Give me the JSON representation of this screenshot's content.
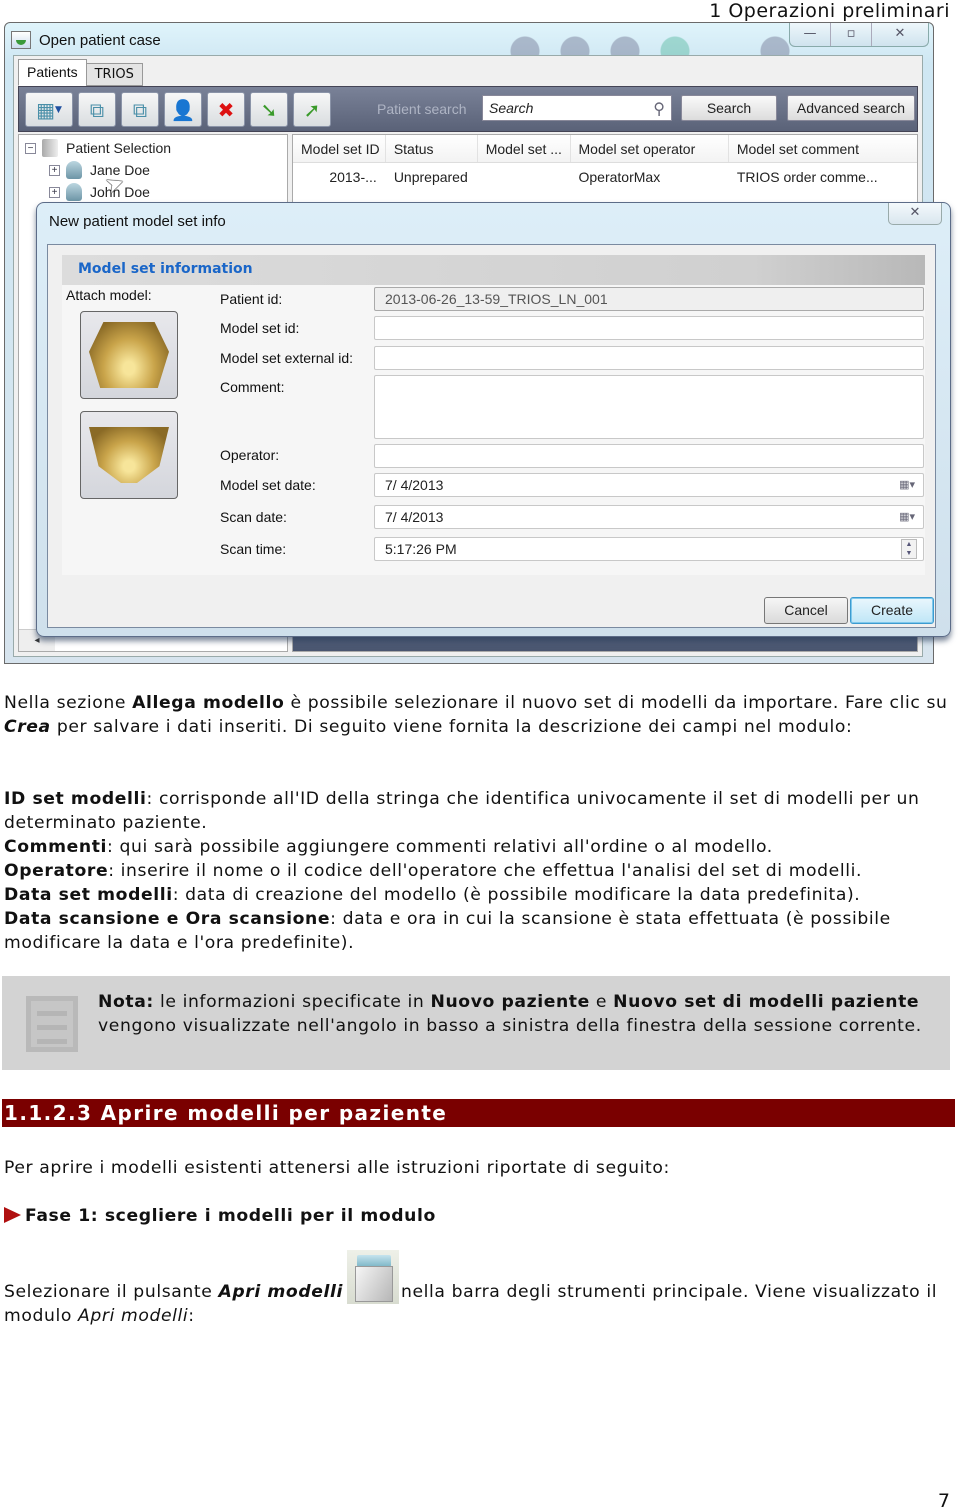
{
  "page": {
    "chapter_header": "1 Operazioni preliminari",
    "page_number": "7"
  },
  "screenshot": {
    "window": {
      "title": "Open patient case",
      "controls": {
        "minimize": "—",
        "maximize": "▫",
        "close": "✕"
      },
      "tabs": [
        {
          "label": "Patients",
          "active": true
        },
        {
          "label": "TRIOS",
          "active": false
        }
      ],
      "toolbar": {
        "buttons": [
          {
            "name": "view-mode",
            "icon": "grid-icon"
          },
          {
            "name": "new-model-set",
            "icon": "model-set-add-icon"
          },
          {
            "name": "open-model-set",
            "icon": "model-set-icon"
          },
          {
            "name": "edit-patient",
            "icon": "patient-edit-icon"
          },
          {
            "name": "delete-patient",
            "icon": "patient-delete-icon"
          },
          {
            "name": "import",
            "icon": "import-icon"
          },
          {
            "name": "export",
            "icon": "export-icon"
          }
        ],
        "patient_search_label": "Patient search",
        "search_placeholder": "Search",
        "search_button": "Search",
        "advanced_search_button": "Advanced search"
      },
      "tree": {
        "root": "Patient Selection",
        "patients": [
          "Jane Doe",
          "John Doe"
        ]
      },
      "grid": {
        "columns": [
          "Model set ID",
          "Status",
          "Model set ...",
          "Model set operator",
          "Model set comment"
        ],
        "rows": [
          [
            "2013-...",
            "Unprepared",
            "",
            "OperatorMax",
            "TRIOS order comme..."
          ]
        ]
      }
    },
    "dialog": {
      "title": "New patient model set info",
      "close": "✕",
      "section_title": "Model set information",
      "attach_label": "Attach model:",
      "fields": [
        {
          "label": "Patient id:",
          "value": "2013-06-26_13-59_TRIOS_LN_001"
        },
        {
          "label": "Model set id:",
          "value": ""
        },
        {
          "label": "Model set external id:",
          "value": ""
        },
        {
          "label": "Comment:",
          "value": ""
        },
        {
          "label": "Operator:",
          "value": ""
        },
        {
          "label": "Model set date:",
          "value": "7/  4/2013"
        },
        {
          "label": "Scan date:",
          "value": "7/  4/2013"
        },
        {
          "label": "Scan time:",
          "value": "5:17:26 PM"
        }
      ],
      "cancel_button": "Cancel",
      "create_button": "Create"
    }
  },
  "document": {
    "intro": {
      "p1_a": "Nella sezione ",
      "p1_b": "Allega modello",
      "p1_c": " è possibile selezionare il nuovo set di modelli da importare. Fare clic su ",
      "p1_d": "Crea",
      "p1_e": " per salvare i dati inseriti. Di seguito viene fornita la descrizione dei campi nel modulo:"
    },
    "definitions": [
      {
        "term": "ID set modelli",
        "text": ": corrisponde all'ID della stringa che identifica univocamente il set di modelli per un determinato paziente."
      },
      {
        "term": "Commenti",
        "text": ": qui sarà possibile aggiungere commenti relativi all'ordine o al modello."
      },
      {
        "term": "Operatore",
        "text": ": inserire il nome o il codice dell'operatore che effettua l'analisi del set di modelli."
      },
      {
        "term": "Data set modelli",
        "text": ": data di creazione del modello (è possibile modificare la data predefinita)."
      },
      {
        "term": "Data scansione e Ora scansione",
        "text": ": data e ora in cui la scansione è stata effettuata (è possibile modificare la data e l'ora predefinite)."
      }
    ],
    "note": {
      "label": "Nota:",
      "t1": " le informazioni specificate in ",
      "b1": "Nuovo paziente",
      "t2": " e ",
      "b2": "Nuovo set di modelli paziente",
      "t3": " vengono visualizzate nell'angolo in basso a sinistra della finestra della sessione corrente."
    },
    "section_heading": "1.1.2.3 Aprire modelli per paziente",
    "section_intro": "Per aprire i modelli esistenti attenersi alle istruzioni riportate di seguito:",
    "step": {
      "label": "Fase 1",
      "text": ": scegliere i modelli per il modulo"
    },
    "step_body": {
      "a": "Selezionare il pulsante ",
      "b": "Apri modelli",
      "c": "nella barra degli strumenti principale. Viene visualizzato il modulo ",
      "d": "Apri modelli",
      "e": ":"
    }
  }
}
